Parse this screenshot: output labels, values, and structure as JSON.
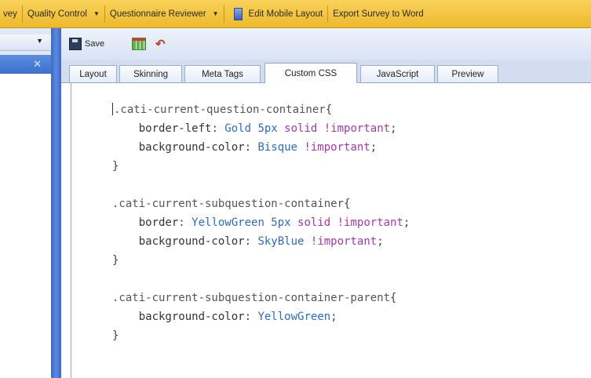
{
  "menubar": {
    "items": [
      {
        "label": "vey",
        "arrow": ""
      },
      {
        "label": "Quality Control",
        "arrow": "▼"
      },
      {
        "label": "Questionnaire Reviewer",
        "arrow": "▼"
      },
      {
        "label": "Edit Mobile Layout",
        "arrow": ""
      },
      {
        "label": "Export Survey to Word",
        "arrow": ""
      }
    ]
  },
  "left_panel": {
    "dropdown_arrow": "▼",
    "close_glyph": "✕"
  },
  "toolbar": {
    "save_label": "Save"
  },
  "tabs": [
    {
      "label": "Layout",
      "active": false
    },
    {
      "label": "Skinning",
      "active": false
    },
    {
      "label": "Meta Tags",
      "active": false
    },
    {
      "label": "Custom CSS",
      "active": true
    },
    {
      "label": "JavaScript",
      "active": false
    },
    {
      "label": "Preview",
      "active": false
    }
  ],
  "editor": {
    "rules": [
      {
        "selector": ".cati-current-question-container",
        "declarations": [
          {
            "prop": "border-left",
            "value": "Gold 5px",
            "keyword": "solid",
            "important": "!important"
          },
          {
            "prop": "background-color",
            "value": "Bisque",
            "keyword": "",
            "important": "!important"
          }
        ]
      },
      {
        "selector": ".cati-current-subquestion-container",
        "declarations": [
          {
            "prop": "border",
            "value": "YellowGreen 5px",
            "keyword": "solid",
            "important": "!important"
          },
          {
            "prop": "background-color",
            "value": "SkyBlue",
            "keyword": "",
            "important": "!important"
          }
        ]
      },
      {
        "selector": ".cati-current-subquestion-container-parent",
        "declarations": [
          {
            "prop": "background-color",
            "value": "YellowGreen",
            "keyword": "",
            "important": ""
          }
        ]
      }
    ]
  }
}
